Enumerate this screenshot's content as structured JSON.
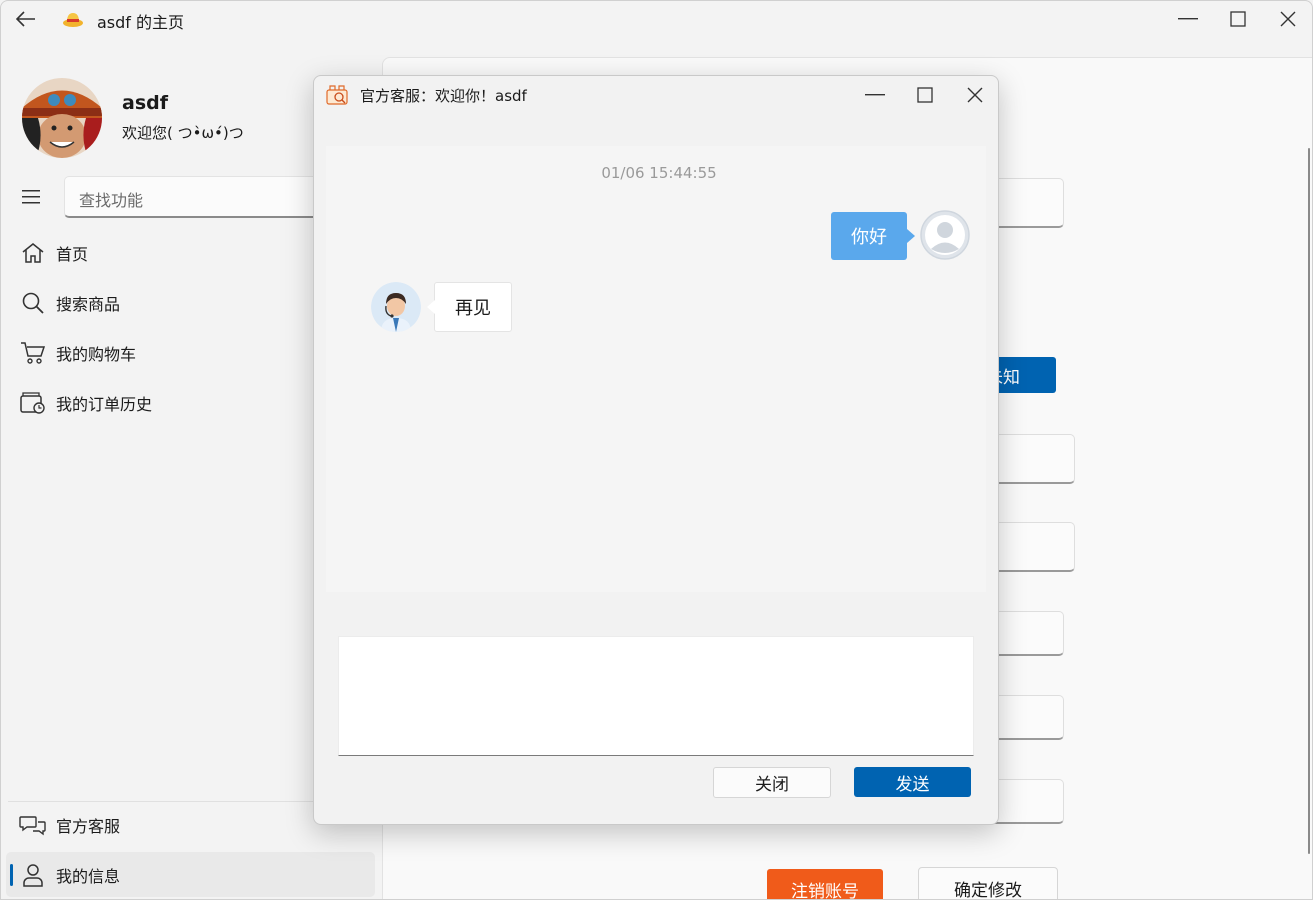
{
  "window": {
    "title": "asdf 的主页",
    "back_icon": "arrow-left-icon",
    "app_icon": "straw-hat-icon"
  },
  "profile": {
    "name": "asdf",
    "greeting": "欢迎您( つ•̀ω•́)つ"
  },
  "search": {
    "placeholder": "查找功能"
  },
  "nav": {
    "items": [
      {
        "label": "首页",
        "icon": "home-icon"
      },
      {
        "label": "搜索商品",
        "icon": "search-icon"
      },
      {
        "label": "我的购物车",
        "icon": "cart-icon"
      },
      {
        "label": "我的订单历史",
        "icon": "order-history-icon"
      }
    ],
    "footer": [
      {
        "label": "官方客服",
        "icon": "chat-icon"
      },
      {
        "label": "我的信息",
        "icon": "person-icon",
        "selected": true
      }
    ]
  },
  "content": {
    "gender_button": "未知",
    "delete_account_button": "注销账号",
    "confirm_button": "确定修改"
  },
  "dialog": {
    "title": "官方客服：欢迎你！asdf",
    "timestamp": "01/06 15:44:55",
    "messages": [
      {
        "from": "user",
        "text": "你好"
      },
      {
        "from": "service",
        "text": "再见"
      }
    ],
    "input_value": "",
    "close_button": "关闭",
    "send_button": "发送"
  },
  "colors": {
    "accent": "#0063b1",
    "user_bubble": "#5aa8ec",
    "danger": "#f05b1a"
  }
}
